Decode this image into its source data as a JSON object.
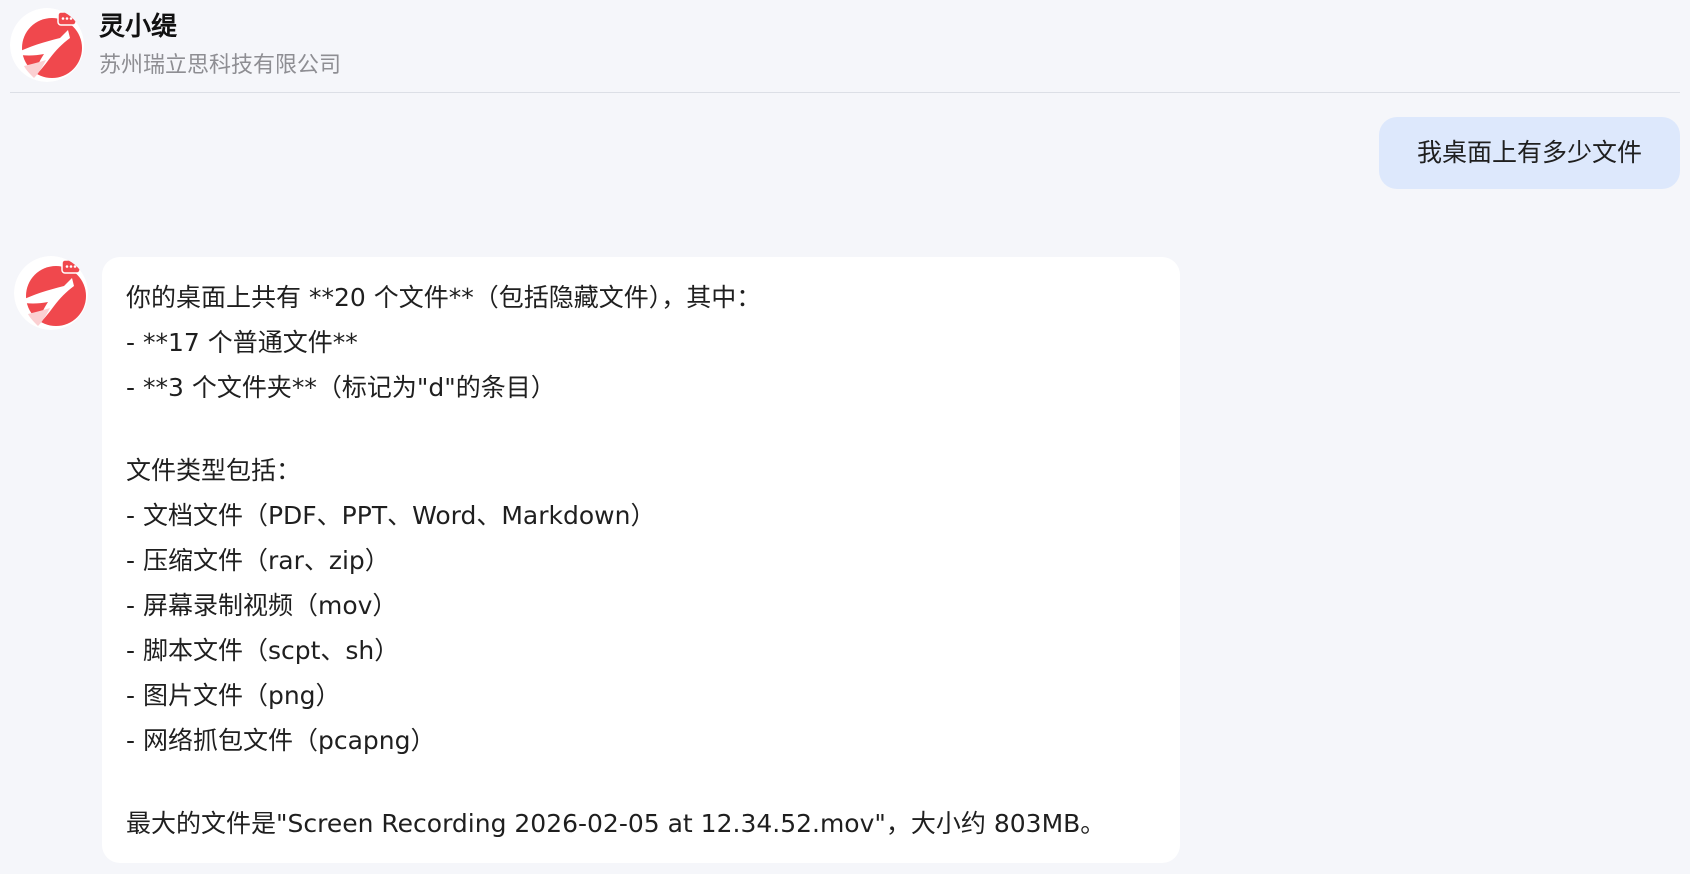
{
  "header": {
    "title": "灵小缇",
    "subtitle": "苏州瑞立思科技有限公司"
  },
  "messages": {
    "user": "我桌面上有多少文件",
    "assistant": {
      "line1": "你的桌面上共有 **20 个文件**（包括隐藏文件），其中：",
      "line2": "- **17 个普通文件**",
      "line3": "- **3 个文件夹**（标记为\"d\"的条目）",
      "line4": "文件类型包括：",
      "line5": "- 文档文件（PDF、PPT、Word、Markdown）",
      "line6": "- 压缩文件（rar、zip）",
      "line7": "- 屏幕录制视频（mov）",
      "line8": "- 脚本文件（scpt、sh）",
      "line9": "- 图片文件（png）",
      "line10": "- 网络抓包文件（pcapng）",
      "line11": "最大的文件是\"Screen Recording 2026-02-05 at 12.34.52.mov\"，大小约 803MB。"
    }
  },
  "icons": {
    "avatar": "bird-logo-icon",
    "chat_badge": "chat-bubble-icon"
  },
  "colors": {
    "brand": "#f0484d",
    "user_bubble": "#dde8fc",
    "background": "#f5f6fa"
  }
}
